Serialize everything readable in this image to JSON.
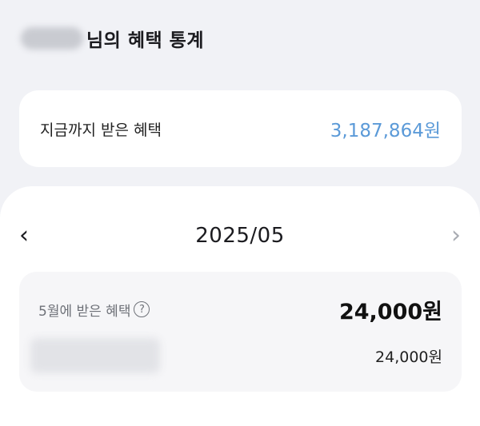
{
  "header": {
    "title": "님의 혜택 통계"
  },
  "summary": {
    "label": "지금까지 받은 혜택",
    "value": "3,187,864원"
  },
  "month_nav": {
    "prev_icon": "chevron-left-icon",
    "prev_glyph": "‹",
    "month": "2025/05",
    "next_icon": "chevron-right-icon",
    "next_glyph": "›"
  },
  "detail": {
    "label": "5월에 받은 혜택",
    "help_glyph": "?",
    "total": "24,000원",
    "items": [
      {
        "amount": "24,000원"
      }
    ]
  },
  "colors": {
    "background": "#f1f2f6",
    "accent": "#5b9ad8",
    "card": "#ffffff",
    "detail_card": "#f6f6f8"
  }
}
